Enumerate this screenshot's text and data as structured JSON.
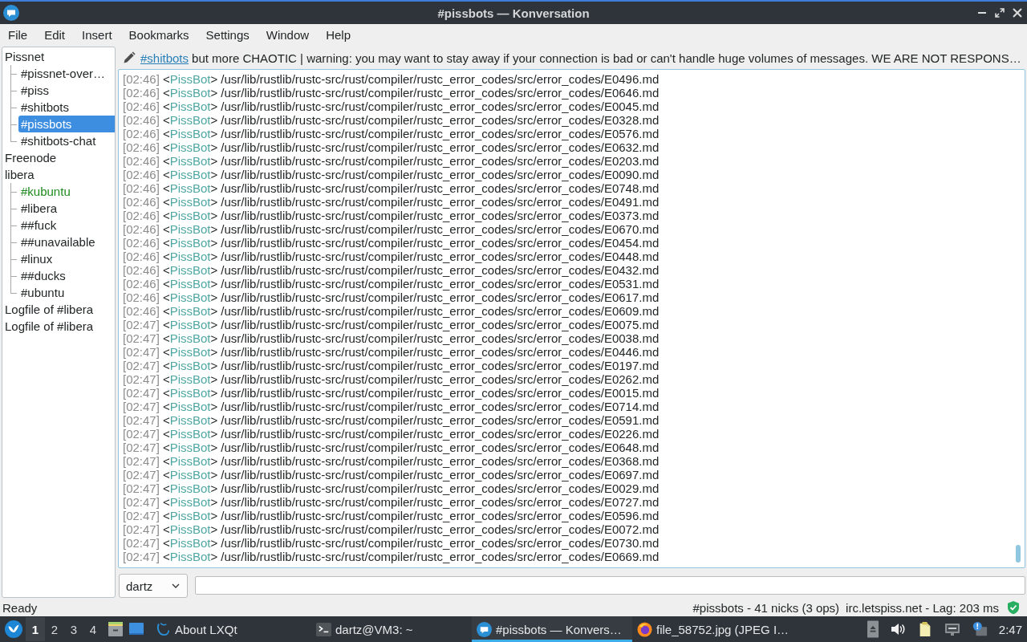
{
  "window": {
    "title": "#pissbots — Konversation"
  },
  "menu": [
    "File",
    "Edit",
    "Insert",
    "Bookmarks",
    "Settings",
    "Window",
    "Help"
  ],
  "sidebar": {
    "items": [
      {
        "label": "Pissnet",
        "selected": false,
        "activity": false,
        "children": [
          {
            "label": "#pissnet-over…",
            "selected": false,
            "activity": false
          },
          {
            "label": "#piss",
            "selected": false,
            "activity": false
          },
          {
            "label": "#shitbots",
            "selected": false,
            "activity": false
          },
          {
            "label": "#pissbots",
            "selected": true,
            "activity": false
          },
          {
            "label": "#shitbots-chat",
            "selected": false,
            "activity": false
          }
        ]
      },
      {
        "label": "Freenode",
        "selected": false,
        "activity": false
      },
      {
        "label": "libera",
        "selected": false,
        "activity": false,
        "children": [
          {
            "label": "#kubuntu",
            "selected": false,
            "activity": true
          },
          {
            "label": "#libera",
            "selected": false,
            "activity": false
          },
          {
            "label": "##fuck",
            "selected": false,
            "activity": false
          },
          {
            "label": "##unavailable",
            "selected": false,
            "activity": false
          },
          {
            "label": "#linux",
            "selected": false,
            "activity": false
          },
          {
            "label": "##ducks",
            "selected": false,
            "activity": false
          },
          {
            "label": "#ubuntu",
            "selected": false,
            "activity": false
          }
        ]
      },
      {
        "label": "Logfile of #libera",
        "selected": false,
        "activity": false
      },
      {
        "label": "Logfile of #libera",
        "selected": false,
        "activity": false
      }
    ]
  },
  "topic": {
    "link": "#shitbots",
    "text": "but more CHAOTIC | warning: you may want to stay away if your connection is bad or can't handle huge volumes of messages. WE ARE NOT RESPONS…"
  },
  "chat": {
    "lines": [
      {
        "time": "[02:46]",
        "open": "<",
        "nick": "PissBot",
        "close": ">",
        "text": "/usr/lib/rustlib/rustc-src/rust/compiler/rustc_error_codes/src/error_codes/E0496.md"
      },
      {
        "time": "[02:46]",
        "open": "<",
        "nick": "PissBot",
        "close": ">",
        "text": "/usr/lib/rustlib/rustc-src/rust/compiler/rustc_error_codes/src/error_codes/E0646.md"
      },
      {
        "time": "[02:46]",
        "open": "<",
        "nick": "PissBot",
        "close": ">",
        "text": "/usr/lib/rustlib/rustc-src/rust/compiler/rustc_error_codes/src/error_codes/E0045.md"
      },
      {
        "time": "[02:46]",
        "open": "<",
        "nick": "PissBot",
        "close": ">",
        "text": "/usr/lib/rustlib/rustc-src/rust/compiler/rustc_error_codes/src/error_codes/E0328.md"
      },
      {
        "time": "[02:46]",
        "open": "<",
        "nick": "PissBot",
        "close": ">",
        "text": "/usr/lib/rustlib/rustc-src/rust/compiler/rustc_error_codes/src/error_codes/E0576.md"
      },
      {
        "time": "[02:46]",
        "open": "<",
        "nick": "PissBot",
        "close": ">",
        "text": "/usr/lib/rustlib/rustc-src/rust/compiler/rustc_error_codes/src/error_codes/E0632.md"
      },
      {
        "time": "[02:46]",
        "open": "<",
        "nick": "PissBot",
        "close": ">",
        "text": "/usr/lib/rustlib/rustc-src/rust/compiler/rustc_error_codes/src/error_codes/E0203.md"
      },
      {
        "time": "[02:46]",
        "open": "<",
        "nick": "PissBot",
        "close": ">",
        "text": "/usr/lib/rustlib/rustc-src/rust/compiler/rustc_error_codes/src/error_codes/E0090.md"
      },
      {
        "time": "[02:46]",
        "open": "<",
        "nick": "PissBot",
        "close": ">",
        "text": "/usr/lib/rustlib/rustc-src/rust/compiler/rustc_error_codes/src/error_codes/E0748.md"
      },
      {
        "time": "[02:46]",
        "open": "<",
        "nick": "PissBot",
        "close": ">",
        "text": "/usr/lib/rustlib/rustc-src/rust/compiler/rustc_error_codes/src/error_codes/E0491.md"
      },
      {
        "time": "[02:46]",
        "open": "<",
        "nick": "PissBot",
        "close": ">",
        "text": "/usr/lib/rustlib/rustc-src/rust/compiler/rustc_error_codes/src/error_codes/E0373.md"
      },
      {
        "time": "[02:46]",
        "open": "<",
        "nick": "PissBot",
        "close": ">",
        "text": "/usr/lib/rustlib/rustc-src/rust/compiler/rustc_error_codes/src/error_codes/E0670.md"
      },
      {
        "time": "[02:46]",
        "open": "<",
        "nick": "PissBot",
        "close": ">",
        "text": "/usr/lib/rustlib/rustc-src/rust/compiler/rustc_error_codes/src/error_codes/E0454.md"
      },
      {
        "time": "[02:46]",
        "open": "<",
        "nick": "PissBot",
        "close": ">",
        "text": "/usr/lib/rustlib/rustc-src/rust/compiler/rustc_error_codes/src/error_codes/E0448.md"
      },
      {
        "time": "[02:46]",
        "open": "<",
        "nick": "PissBot",
        "close": ">",
        "text": "/usr/lib/rustlib/rustc-src/rust/compiler/rustc_error_codes/src/error_codes/E0432.md"
      },
      {
        "time": "[02:46]",
        "open": "<",
        "nick": "PissBot",
        "close": ">",
        "text": "/usr/lib/rustlib/rustc-src/rust/compiler/rustc_error_codes/src/error_codes/E0531.md"
      },
      {
        "time": "[02:46]",
        "open": "<",
        "nick": "PissBot",
        "close": ">",
        "text": "/usr/lib/rustlib/rustc-src/rust/compiler/rustc_error_codes/src/error_codes/E0617.md"
      },
      {
        "time": "[02:46]",
        "open": "<",
        "nick": "PissBot",
        "close": ">",
        "text": "/usr/lib/rustlib/rustc-src/rust/compiler/rustc_error_codes/src/error_codes/E0609.md"
      },
      {
        "time": "[02:47]",
        "open": "<",
        "nick": "PissBot",
        "close": ">",
        "text": "/usr/lib/rustlib/rustc-src/rust/compiler/rustc_error_codes/src/error_codes/E0075.md"
      },
      {
        "time": "[02:47]",
        "open": "<",
        "nick": "PissBot",
        "close": ">",
        "text": "/usr/lib/rustlib/rustc-src/rust/compiler/rustc_error_codes/src/error_codes/E0038.md"
      },
      {
        "time": "[02:47]",
        "open": "<",
        "nick": "PissBot",
        "close": ">",
        "text": "/usr/lib/rustlib/rustc-src/rust/compiler/rustc_error_codes/src/error_codes/E0446.md"
      },
      {
        "time": "[02:47]",
        "open": "<",
        "nick": "PissBot",
        "close": ">",
        "text": "/usr/lib/rustlib/rustc-src/rust/compiler/rustc_error_codes/src/error_codes/E0197.md"
      },
      {
        "time": "[02:47]",
        "open": "<",
        "nick": "PissBot",
        "close": ">",
        "text": "/usr/lib/rustlib/rustc-src/rust/compiler/rustc_error_codes/src/error_codes/E0262.md"
      },
      {
        "time": "[02:47]",
        "open": "<",
        "nick": "PissBot",
        "close": ">",
        "text": "/usr/lib/rustlib/rustc-src/rust/compiler/rustc_error_codes/src/error_codes/E0015.md"
      },
      {
        "time": "[02:47]",
        "open": "<",
        "nick": "PissBot",
        "close": ">",
        "text": "/usr/lib/rustlib/rustc-src/rust/compiler/rustc_error_codes/src/error_codes/E0714.md"
      },
      {
        "time": "[02:47]",
        "open": "<",
        "nick": "PissBot",
        "close": ">",
        "text": "/usr/lib/rustlib/rustc-src/rust/compiler/rustc_error_codes/src/error_codes/E0591.md"
      },
      {
        "time": "[02:47]",
        "open": "<",
        "nick": "PissBot",
        "close": ">",
        "text": "/usr/lib/rustlib/rustc-src/rust/compiler/rustc_error_codes/src/error_codes/E0226.md"
      },
      {
        "time": "[02:47]",
        "open": "<",
        "nick": "PissBot",
        "close": ">",
        "text": "/usr/lib/rustlib/rustc-src/rust/compiler/rustc_error_codes/src/error_codes/E0648.md"
      },
      {
        "time": "[02:47]",
        "open": "<",
        "nick": "PissBot",
        "close": ">",
        "text": "/usr/lib/rustlib/rustc-src/rust/compiler/rustc_error_codes/src/error_codes/E0368.md"
      },
      {
        "time": "[02:47]",
        "open": "<",
        "nick": "PissBot",
        "close": ">",
        "text": "/usr/lib/rustlib/rustc-src/rust/compiler/rustc_error_codes/src/error_codes/E0697.md"
      },
      {
        "time": "[02:47]",
        "open": "<",
        "nick": "PissBot",
        "close": ">",
        "text": "/usr/lib/rustlib/rustc-src/rust/compiler/rustc_error_codes/src/error_codes/E0029.md"
      },
      {
        "time": "[02:47]",
        "open": "<",
        "nick": "PissBot",
        "close": ">",
        "text": "/usr/lib/rustlib/rustc-src/rust/compiler/rustc_error_codes/src/error_codes/E0727.md"
      },
      {
        "time": "[02:47]",
        "open": "<",
        "nick": "PissBot",
        "close": ">",
        "text": "/usr/lib/rustlib/rustc-src/rust/compiler/rustc_error_codes/src/error_codes/E0596.md"
      },
      {
        "time": "[02:47]",
        "open": "<",
        "nick": "PissBot",
        "close": ">",
        "text": "/usr/lib/rustlib/rustc-src/rust/compiler/rustc_error_codes/src/error_codes/E0072.md"
      },
      {
        "time": "[02:47]",
        "open": "<",
        "nick": "PissBot",
        "close": ">",
        "text": "/usr/lib/rustlib/rustc-src/rust/compiler/rustc_error_codes/src/error_codes/E0730.md"
      },
      {
        "time": "[02:47]",
        "open": "<",
        "nick": "PissBot",
        "close": ">",
        "text": "/usr/lib/rustlib/rustc-src/rust/compiler/rustc_error_codes/src/error_codes/E0669.md"
      }
    ]
  },
  "input": {
    "nick": "dartz"
  },
  "status_bar": {
    "message": "Ready",
    "channel_info": "#pissbots - 41 nicks (3 ops)",
    "server_info": "irc.letspiss.net - Lag: 203 ms"
  },
  "taskbar": {
    "desktops": [
      {
        "label": "1",
        "selected": true
      },
      {
        "label": "2",
        "selected": false
      },
      {
        "label": "3",
        "selected": false
      },
      {
        "label": "4",
        "selected": false
      }
    ],
    "tasks": [
      {
        "kind": "about",
        "label": "About LXQt",
        "selected": false
      },
      {
        "kind": "terminal",
        "label": "dartz@VM3: ~",
        "selected": false
      },
      {
        "kind": "chat",
        "label": "#pissbots — Konvers…",
        "selected": true
      },
      {
        "kind": "browser",
        "label": "file_58752.jpg (JPEG I…",
        "selected": false
      }
    ],
    "clock": "2:47"
  }
}
